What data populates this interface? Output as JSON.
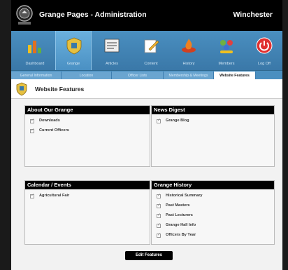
{
  "header": {
    "app_title": "Grange Pages - Administration",
    "user": "Winchester"
  },
  "nav": {
    "items": [
      {
        "label": "Dashboard",
        "icon": "dashboard-icon"
      },
      {
        "label": "Grange",
        "icon": "grange-icon"
      },
      {
        "label": "Articles",
        "icon": "articles-icon"
      },
      {
        "label": "Content",
        "icon": "content-icon"
      },
      {
        "label": "History",
        "icon": "history-icon"
      },
      {
        "label": "Members",
        "icon": "members-icon"
      },
      {
        "label": "Log Off",
        "icon": "power-icon"
      }
    ]
  },
  "tabs": {
    "items": [
      {
        "label": "General Information"
      },
      {
        "label": "Location"
      },
      {
        "label": "Officer Lists"
      },
      {
        "label": "Membership & Meetings"
      },
      {
        "label": "Website Features"
      }
    ],
    "active": "Website Features"
  },
  "page": {
    "title": "Website Features"
  },
  "panels": {
    "about": {
      "title": "About Our Grange",
      "items": [
        "Downloads",
        "Current Officers"
      ]
    },
    "news": {
      "title": "News Digest",
      "items": [
        "Grange Blog"
      ]
    },
    "calendar": {
      "title": "Calendar / Events",
      "items": [
        "Agricultural Fair"
      ]
    },
    "history": {
      "title": "Grange History",
      "items": [
        "Historical Summary",
        "Past Masters",
        "Past Lecturers",
        "Grange Hall Info",
        "Officers By Year"
      ]
    }
  },
  "actions": {
    "edit_label": "Edit Features"
  },
  "colors": {
    "nav_bg": "#3a78a8",
    "header_bg": "#000000",
    "accent": "#4a8fc0"
  }
}
